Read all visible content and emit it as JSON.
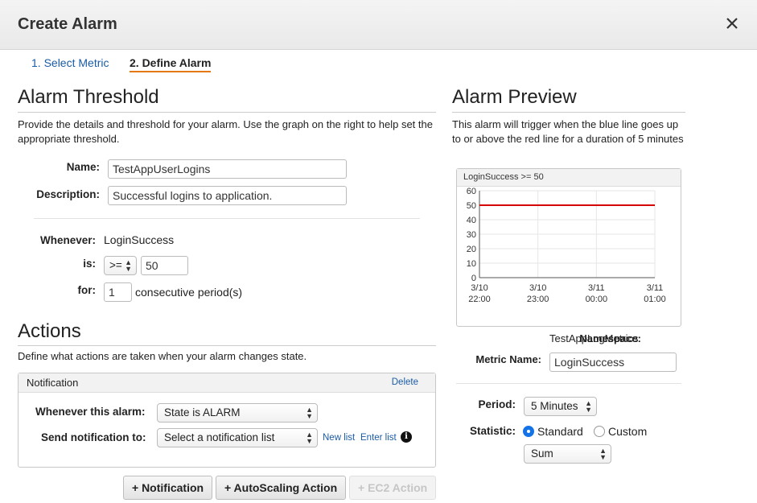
{
  "dialog": {
    "title": "Create Alarm",
    "close_icon": "close-icon"
  },
  "steps": [
    {
      "label": "1. Select Metric"
    },
    {
      "label": "2. Define Alarm"
    }
  ],
  "threshold": {
    "heading": "Alarm Threshold",
    "description": "Provide the details and threshold for your alarm. Use the graph on the right to help set the appropriate threshold.",
    "name_label": "Name:",
    "name_value": "TestAppUserLogins",
    "description_label": "Description:",
    "description_value": "Successful logins to application.",
    "whenever_label": "Whenever:",
    "whenever_value": "LoginSuccess",
    "is_label": "is:",
    "operator": ">=",
    "threshold_value": "50",
    "for_label": "for:",
    "periods_value": "1",
    "periods_suffix": "consecutive period(s)"
  },
  "actions": {
    "heading": "Actions",
    "description": "Define what actions are taken when your alarm changes state.",
    "notification": {
      "title": "Notification",
      "delete_label": "Delete",
      "whenever_label": "Whenever this alarm:",
      "state_value": "State is ALARM",
      "send_label": "Send notification to:",
      "send_value": "Select a notification list",
      "new_list_label": "New list",
      "enter_list_label": "Enter list",
      "info_icon": "info-icon"
    },
    "buttons": {
      "notification": "+ Notification",
      "autoscaling": "+ AutoScaling Action",
      "ec2": "+ EC2 Action"
    }
  },
  "preview": {
    "heading": "Alarm Preview",
    "description": "This alarm will trigger when the blue line goes up to or above the red line for a duration of 5 minutes",
    "namespace_label": "Namespace:",
    "namespace_value": "TestAppLogMetrics",
    "metric_label": "Metric Name:",
    "metric_value": "LoginSuccess",
    "period_label": "Period:",
    "period_value": "5 Minutes",
    "statistic_label": "Statistic:",
    "standard_label": "Standard",
    "custom_label": "Custom",
    "statistic_selected": "Standard",
    "stat_value": "Sum"
  },
  "chart_data": {
    "type": "line",
    "title": "LoginSuccess >= 50",
    "ylim": [
      0,
      60
    ],
    "y_ticks": [
      "60",
      "50",
      "40",
      "30",
      "20",
      "10",
      "0"
    ],
    "x_ticks": [
      {
        "date": "3/10",
        "time": "22:00"
      },
      {
        "date": "3/10",
        "time": "23:00"
      },
      {
        "date": "3/11",
        "time": "00:00"
      },
      {
        "date": "3/11",
        "time": "01:00"
      }
    ],
    "series": [
      {
        "color": "#d40000",
        "values": [
          50,
          50,
          50,
          50
        ]
      }
    ]
  }
}
